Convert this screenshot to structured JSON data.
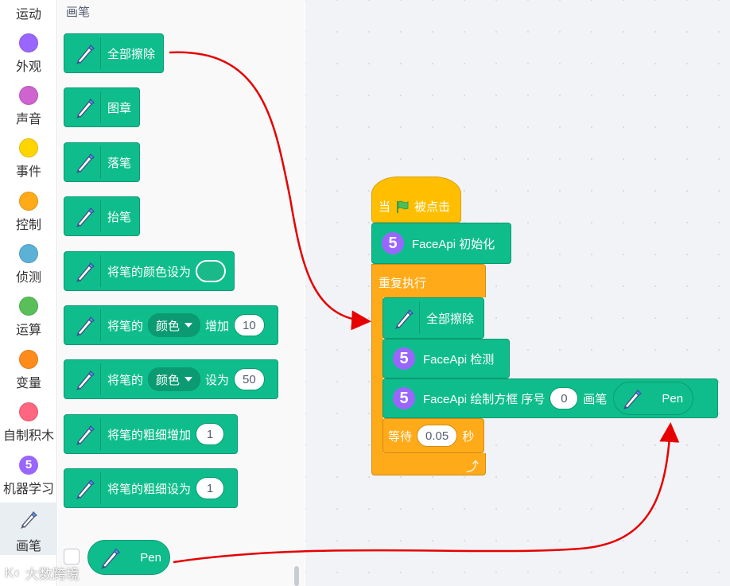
{
  "sidebar": {
    "items": [
      {
        "label": "运动",
        "color": "#4c97ff"
      },
      {
        "label": "外观",
        "color": "#9966ff"
      },
      {
        "label": "声音",
        "color": "#cf63cf"
      },
      {
        "label": "事件",
        "color": "#ffd500"
      },
      {
        "label": "控制",
        "color": "#ffab19"
      },
      {
        "label": "侦测",
        "color": "#5cb1d6"
      },
      {
        "label": "运算",
        "color": "#59c059"
      },
      {
        "label": "变量",
        "color": "#ff8c1a"
      },
      {
        "label": "自制积木",
        "color": "#ff6680"
      },
      {
        "label": "机器学习",
        "badge": "5",
        "color": "#9966ff"
      },
      {
        "label": "画笔",
        "icon": "pen-icon",
        "selected": true
      }
    ]
  },
  "flyout": {
    "title": "画笔",
    "blocks": {
      "clear": "全部擦除",
      "stamp": "图章",
      "pen_down": "落笔",
      "pen_up": "抬笔",
      "set_color_to": "将笔的颜色设为",
      "change_param_prefix": "将笔的",
      "change_param_dropdown": "颜色",
      "change_param_by": "增加",
      "change_param_value": "10",
      "set_param_prefix": "将笔的",
      "set_param_dropdown": "颜色",
      "set_param_to": "设为",
      "set_param_value": "50",
      "change_size": "将笔的粗细增加",
      "change_size_value": "1",
      "set_size": "将笔的粗细设为",
      "set_size_value": "1"
    },
    "pen_reporter": "Pen"
  },
  "workspace": {
    "hat": {
      "when": "当",
      "clicked": "被点击"
    },
    "faceapi_init": {
      "badge": "5",
      "label": "FaceApi 初始化"
    },
    "forever": "重复执行",
    "clear": "全部擦除",
    "faceapi_detect": {
      "badge": "5",
      "label": "FaceApi 检测"
    },
    "faceapi_draw": {
      "badge": "5",
      "label": "FaceApi 绘制方框 序号",
      "index": "0",
      "pen_label": "画笔",
      "pen_value": "Pen"
    },
    "wait": {
      "label": "等待",
      "value": "0.05",
      "unit": "秒"
    }
  },
  "watermark": "大数跨境",
  "colors": {
    "pen_block": "#0fbd8c",
    "control": "#ffab19",
    "event": "#ffbf00",
    "ml": "#9966ff",
    "annotation_arrow": "#e60000"
  }
}
